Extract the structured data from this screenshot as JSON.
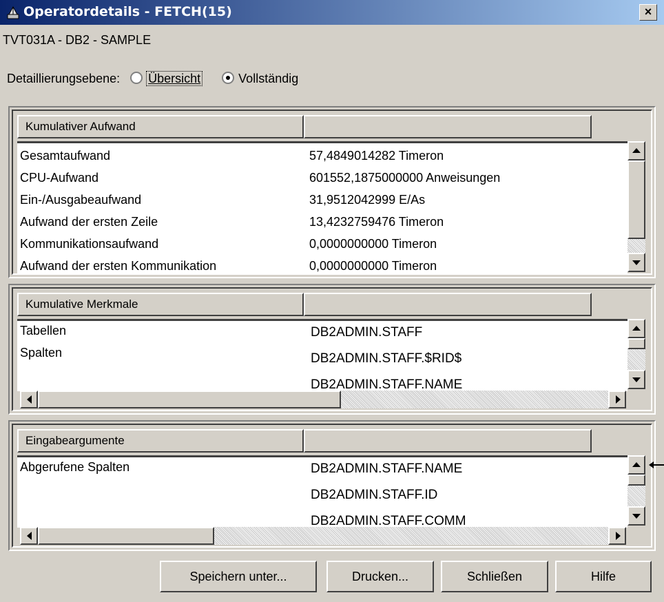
{
  "window": {
    "title": "Operatordetails - FETCH(15)",
    "close_label": "×"
  },
  "subtitle": "TVT031A - DB2 - SAMPLE",
  "detail_level": {
    "label": "Detaillierungsebene:",
    "options": [
      {
        "label": "Übersicht",
        "selected": false
      },
      {
        "label": "Vollständig",
        "selected": true
      }
    ]
  },
  "panels": [
    {
      "header": "Kumulativer Aufwand",
      "rows": [
        {
          "name": "Gesamtaufwand",
          "value": "57,4849014282 Timeron"
        },
        {
          "name": "CPU-Aufwand",
          "value": "601552,1875000000 Anweisungen"
        },
        {
          "name": "Ein-/Ausgabeaufwand",
          "value": "31,9512042999 E/As"
        },
        {
          "name": "Aufwand der ersten Zeile",
          "value": "13,4232759476 Timeron"
        },
        {
          "name": "Kommunikationsaufwand",
          "value": "0,0000000000 Timeron"
        },
        {
          "name": "Aufwand der ersten Kommunikation",
          "value": "0,0000000000 Timeron"
        }
      ]
    },
    {
      "header": "Kumulative Merkmale",
      "labels": [
        "Tabellen",
        "Spalten"
      ],
      "values": [
        "DB2ADMIN.STAFF",
        "DB2ADMIN.STAFF.$RID$",
        "DB2ADMIN.STAFF.NAME"
      ]
    },
    {
      "header": "Eingabeargumente",
      "labels": [
        "Abgerufene Spalten"
      ],
      "values": [
        "DB2ADMIN.STAFF.NAME",
        "DB2ADMIN.STAFF.ID",
        "DB2ADMIN.STAFF.COMM"
      ]
    }
  ],
  "buttons": [
    "Speichern unter...",
    "Drucken...",
    "Schließen",
    "Hilfe"
  ],
  "colors": {
    "title_start": "#0a246a",
    "title_end": "#a6caf0",
    "face": "#d4d0c8"
  }
}
